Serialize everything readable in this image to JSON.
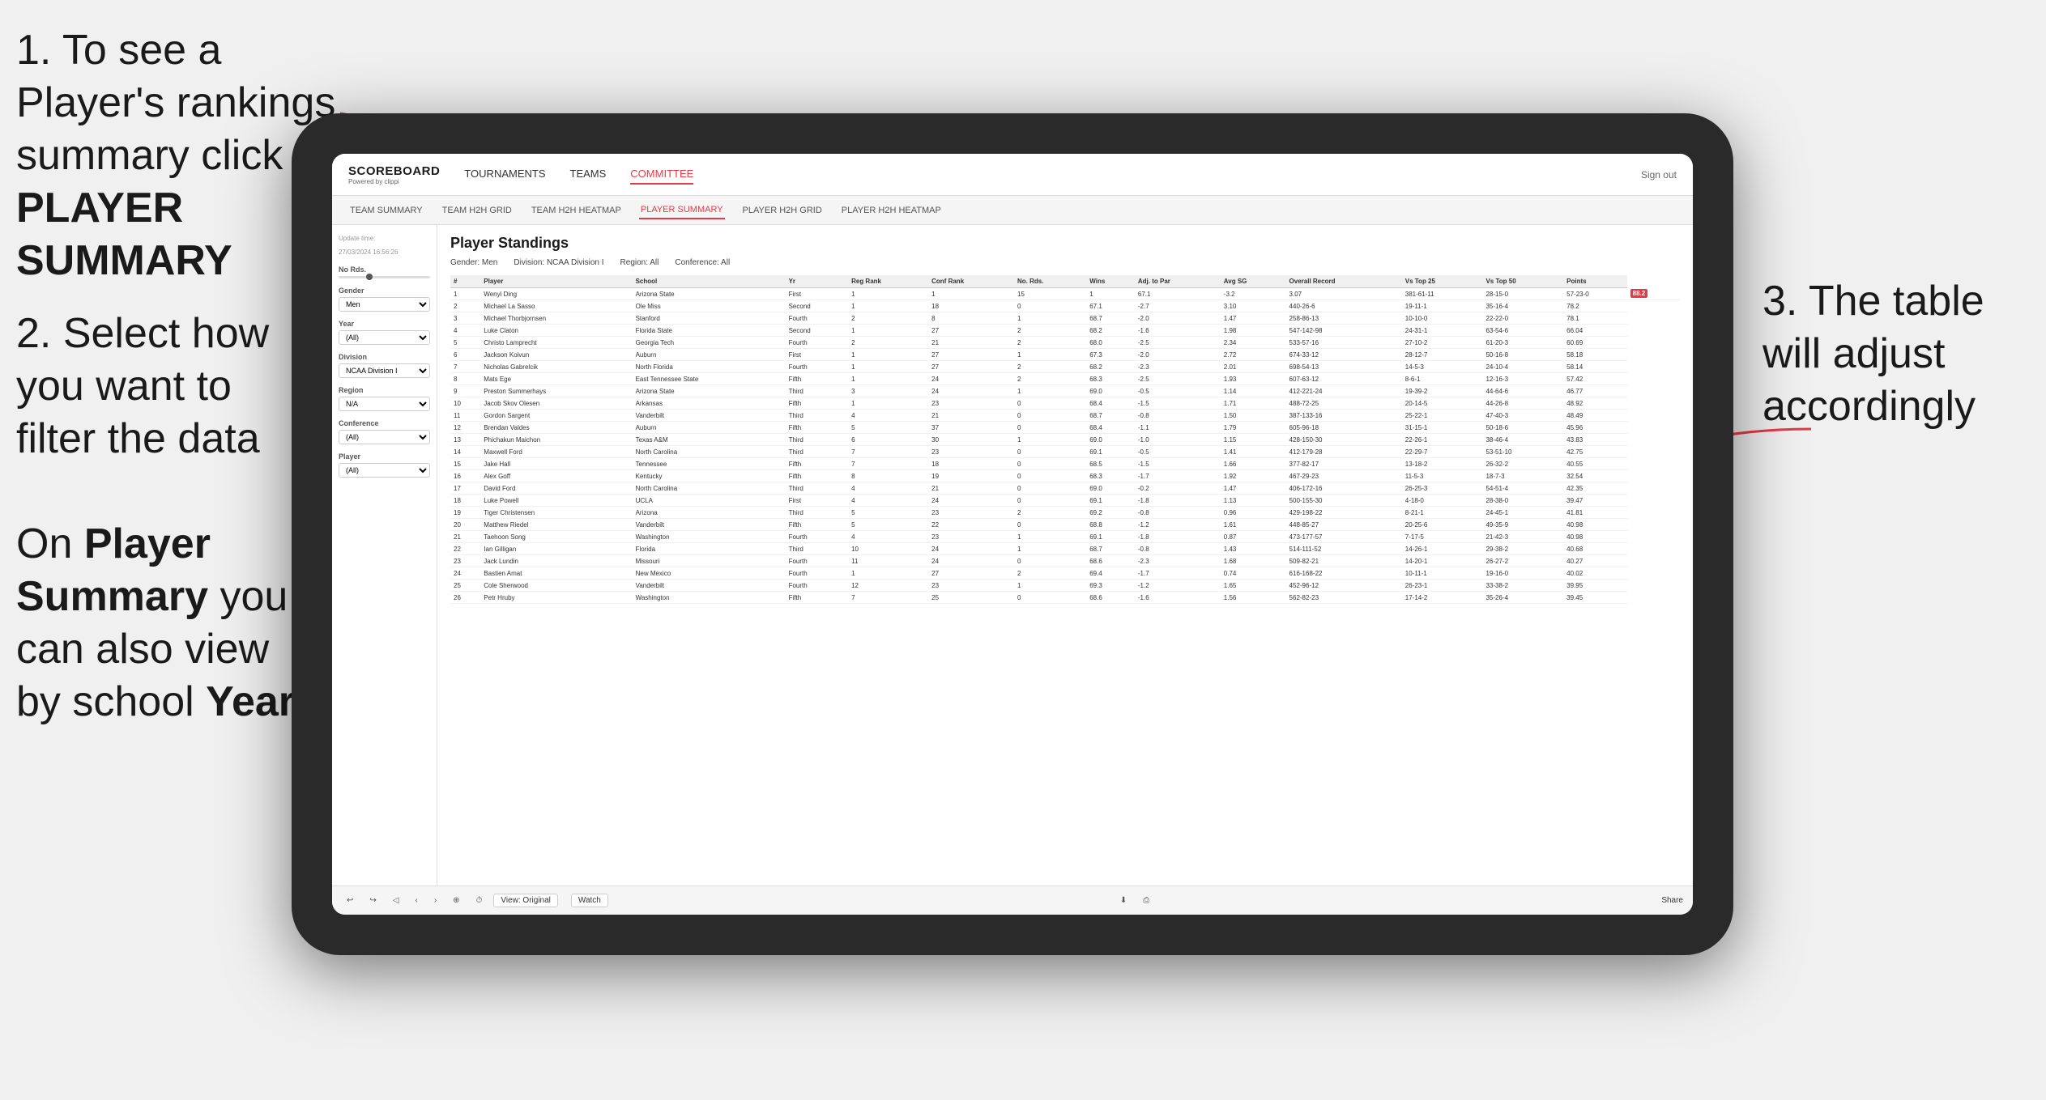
{
  "instructions": {
    "step1": "1. To see a Player's rankings summary click ",
    "step1_bold": "PLAYER SUMMARY",
    "step2": "2. Select how you want to filter the data",
    "step_bottom_1": "On ",
    "step_bottom_bold": "Player Summary",
    "step_bottom_2": " you can also view by school ",
    "step_bottom_year": "Year",
    "step3": "3. The table will adjust accordingly"
  },
  "nav": {
    "logo": "SCOREBOARD",
    "logo_sub": "Powered by clippi",
    "items": [
      "TOURNAMENTS",
      "TEAMS",
      "COMMITTEE"
    ],
    "sign_out": "Sign out"
  },
  "sub_nav": {
    "items": [
      "TEAM SUMMARY",
      "TEAM H2H GRID",
      "TEAM H2H HEATMAP",
      "PLAYER SUMMARY",
      "PLAYER H2H GRID",
      "PLAYER H2H HEATMAP"
    ],
    "active": "PLAYER SUMMARY"
  },
  "sidebar": {
    "update_label": "Update time:",
    "update_time": "27/03/2024 16:56:26",
    "no_rds_label": "No Rds.",
    "gender_label": "Gender",
    "gender_value": "Men",
    "year_label": "Year",
    "year_value": "(All)",
    "division_label": "Division",
    "division_value": "NCAA Division I",
    "region_label": "Region",
    "region_value": "N/A",
    "conference_label": "Conference",
    "conference_value": "(All)",
    "player_label": "Player",
    "player_value": "(All)"
  },
  "table": {
    "title": "Player Standings",
    "filters": {
      "gender": "Gender: Men",
      "division": "Division: NCAA Division I",
      "region": "Region: All",
      "conference": "Conference: All"
    },
    "columns": [
      "#",
      "Player",
      "School",
      "Yr",
      "Reg Rank",
      "Conf Rank",
      "No. Rds.",
      "Wins",
      "Adj. to Par",
      "Avg SG",
      "Overall Record",
      "Vs Top 25",
      "Vs Top 50",
      "Points"
    ],
    "rows": [
      [
        "1",
        "Wenyi Ding",
        "Arizona State",
        "First",
        "1",
        "1",
        "15",
        "1",
        "67.1",
        "-3.2",
        "3.07",
        "381-61-11",
        "28-15-0",
        "57-23-0",
        "88.2"
      ],
      [
        "2",
        "Michael La Sasso",
        "Ole Miss",
        "Second",
        "1",
        "18",
        "0",
        "67.1",
        "-2.7",
        "3.10",
        "440-26-6",
        "19-11-1",
        "35-16-4",
        "78.2"
      ],
      [
        "3",
        "Michael Thorbjornsen",
        "Stanford",
        "Fourth",
        "2",
        "8",
        "1",
        "68.7",
        "-2.0",
        "1.47",
        "258-86-13",
        "10-10-0",
        "22-22-0",
        "78.1"
      ],
      [
        "4",
        "Luke Claton",
        "Florida State",
        "Second",
        "1",
        "27",
        "2",
        "68.2",
        "-1.6",
        "1.98",
        "547-142-98",
        "24-31-1",
        "63-54-6",
        "66.04"
      ],
      [
        "5",
        "Christo Lamprecht",
        "Georgia Tech",
        "Fourth",
        "2",
        "21",
        "2",
        "68.0",
        "-2.5",
        "2.34",
        "533-57-16",
        "27-10-2",
        "61-20-3",
        "60.69"
      ],
      [
        "6",
        "Jackson Koivun",
        "Auburn",
        "First",
        "1",
        "27",
        "1",
        "67.3",
        "-2.0",
        "2.72",
        "674-33-12",
        "28-12-7",
        "50-16-8",
        "58.18"
      ],
      [
        "7",
        "Nicholas Gabrelcik",
        "North Florida",
        "Fourth",
        "1",
        "27",
        "2",
        "68.2",
        "-2.3",
        "2.01",
        "698-54-13",
        "14-5-3",
        "24-10-4",
        "58.14"
      ],
      [
        "8",
        "Mats Ege",
        "East Tennessee State",
        "Fifth",
        "1",
        "24",
        "2",
        "68.3",
        "-2.5",
        "1.93",
        "607-63-12",
        "8-6-1",
        "12-16-3",
        "57.42"
      ],
      [
        "9",
        "Preston Summerhays",
        "Arizona State",
        "Third",
        "3",
        "24",
        "1",
        "69.0",
        "-0.5",
        "1.14",
        "412-221-24",
        "19-39-2",
        "44-64-6",
        "46.77"
      ],
      [
        "10",
        "Jacob Skov Olesen",
        "Arkansas",
        "Fifth",
        "1",
        "23",
        "0",
        "68.4",
        "-1.5",
        "1.71",
        "488-72-25",
        "20-14-5",
        "44-26-8",
        "48.92"
      ],
      [
        "11",
        "Gordon Sargent",
        "Vanderbilt",
        "Third",
        "4",
        "21",
        "0",
        "68.7",
        "-0.8",
        "1.50",
        "387-133-16",
        "25-22-1",
        "47-40-3",
        "48.49"
      ],
      [
        "12",
        "Brendan Valdes",
        "Auburn",
        "Fifth",
        "5",
        "37",
        "0",
        "68.4",
        "-1.1",
        "1.79",
        "605-96-18",
        "31-15-1",
        "50-18-6",
        "45.96"
      ],
      [
        "13",
        "Phichakun Maichon",
        "Texas A&M",
        "Third",
        "6",
        "30",
        "1",
        "69.0",
        "-1.0",
        "1.15",
        "428-150-30",
        "22-26-1",
        "38-46-4",
        "43.83"
      ],
      [
        "14",
        "Maxwell Ford",
        "North Carolina",
        "Third",
        "7",
        "23",
        "0",
        "69.1",
        "-0.5",
        "1.41",
        "412-179-28",
        "22-29-7",
        "53-51-10",
        "42.75"
      ],
      [
        "15",
        "Jake Hall",
        "Tennessee",
        "Fifth",
        "7",
        "18",
        "0",
        "68.5",
        "-1.5",
        "1.66",
        "377-82-17",
        "13-18-2",
        "26-32-2",
        "40.55"
      ],
      [
        "16",
        "Alex Goff",
        "Kentucky",
        "Fifth",
        "8",
        "19",
        "0",
        "68.3",
        "-1.7",
        "1.92",
        "467-29-23",
        "11-5-3",
        "18-7-3",
        "32.54"
      ],
      [
        "17",
        "David Ford",
        "North Carolina",
        "Third",
        "4",
        "21",
        "0",
        "69.0",
        "-0.2",
        "1.47",
        "406-172-16",
        "26-25-3",
        "54-51-4",
        "42.35"
      ],
      [
        "18",
        "Luke Powell",
        "UCLA",
        "First",
        "4",
        "24",
        "0",
        "69.1",
        "-1.8",
        "1.13",
        "500-155-30",
        "4-18-0",
        "28-38-0",
        "39.47"
      ],
      [
        "19",
        "Tiger Christensen",
        "Arizona",
        "Third",
        "5",
        "23",
        "2",
        "69.2",
        "-0.8",
        "0.96",
        "429-198-22",
        "8-21-1",
        "24-45-1",
        "41.81"
      ],
      [
        "20",
        "Matthew Riedel",
        "Vanderbilt",
        "Fifth",
        "5",
        "22",
        "0",
        "68.8",
        "-1.2",
        "1.61",
        "448-85-27",
        "20-25-6",
        "49-35-9",
        "40.98"
      ],
      [
        "21",
        "Taehoon Song",
        "Washington",
        "Fourth",
        "4",
        "23",
        "1",
        "69.1",
        "-1.8",
        "0.87",
        "473-177-57",
        "7-17-5",
        "21-42-3",
        "40.98"
      ],
      [
        "22",
        "Ian Gilligan",
        "Florida",
        "Third",
        "10",
        "24",
        "1",
        "68.7",
        "-0.8",
        "1.43",
        "514-111-52",
        "14-26-1",
        "29-38-2",
        "40.68"
      ],
      [
        "23",
        "Jack Lundin",
        "Missouri",
        "Fourth",
        "11",
        "24",
        "0",
        "68.6",
        "-2.3",
        "1.68",
        "509-82-21",
        "14-20-1",
        "26-27-2",
        "40.27"
      ],
      [
        "24",
        "Bastien Amat",
        "New Mexico",
        "Fourth",
        "1",
        "27",
        "2",
        "69.4",
        "-1.7",
        "0.74",
        "616-168-22",
        "10-11-1",
        "19-16-0",
        "40.02"
      ],
      [
        "25",
        "Cole Sherwood",
        "Vanderbilt",
        "Fourth",
        "12",
        "23",
        "1",
        "69.3",
        "-1.2",
        "1.65",
        "452-96-12",
        "26-23-1",
        "33-38-2",
        "39.95"
      ],
      [
        "26",
        "Petr Hruby",
        "Washington",
        "Fifth",
        "7",
        "25",
        "0",
        "68.6",
        "-1.6",
        "1.56",
        "562-82-23",
        "17-14-2",
        "35-26-4",
        "39.45"
      ]
    ]
  },
  "toolbar": {
    "view_label": "View: Original",
    "watch_label": "Watch",
    "share_label": "Share"
  }
}
